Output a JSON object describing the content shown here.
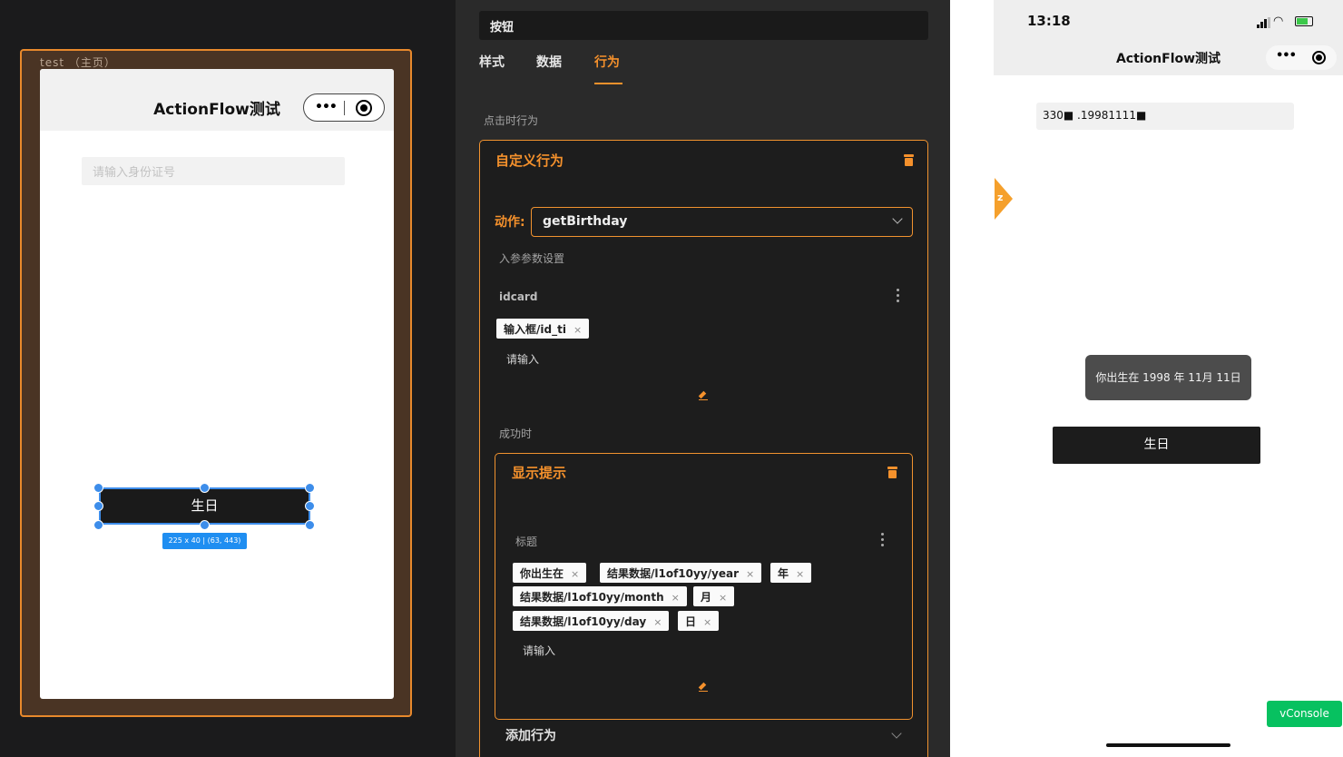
{
  "editor": {
    "page_label": "test （主页）",
    "phone_title": "ActionFlow测试",
    "input_placeholder": "请输入身份证号",
    "button_label": "生日",
    "size_tag": "225 x 40 | (63, 443)"
  },
  "panel": {
    "component_name": "按钮",
    "tabs": [
      {
        "label": "样式",
        "active": false
      },
      {
        "label": "数据",
        "active": false
      },
      {
        "label": "行为",
        "active": true
      }
    ],
    "on_click_label": "点击时行为",
    "custom_action": {
      "title": "自定义行为",
      "action_label": "动作:",
      "action_value": "getBirthday",
      "params_label": "入参参数设置",
      "param_name": "idcard",
      "param_chip": "输入框/id_ti",
      "param_placeholder": "请输入"
    },
    "success_label": "成功时",
    "show_toast": {
      "title": "显示提示",
      "field_label": "标题",
      "chips": [
        "你出生在",
        "结果数据/l1of10yy/year",
        "年",
        "结果数据/l1of10yy/month",
        "月",
        "结果数据/l1of10yy/day",
        "日"
      ],
      "placeholder": "请输入"
    },
    "add_action_label": "添加行为"
  },
  "preview": {
    "time": "13:18",
    "title": "ActionFlow测试",
    "input_value": "330■  .19981111■",
    "side_tab_letter": "z",
    "toast_text": "你出生在 1998 年 11月 11日",
    "button_label": "生日",
    "vconsole_label": "vConsole"
  },
  "colors": {
    "accent": "#f5912c",
    "selection": "#3d8dea",
    "vconsole": "#07c160"
  }
}
